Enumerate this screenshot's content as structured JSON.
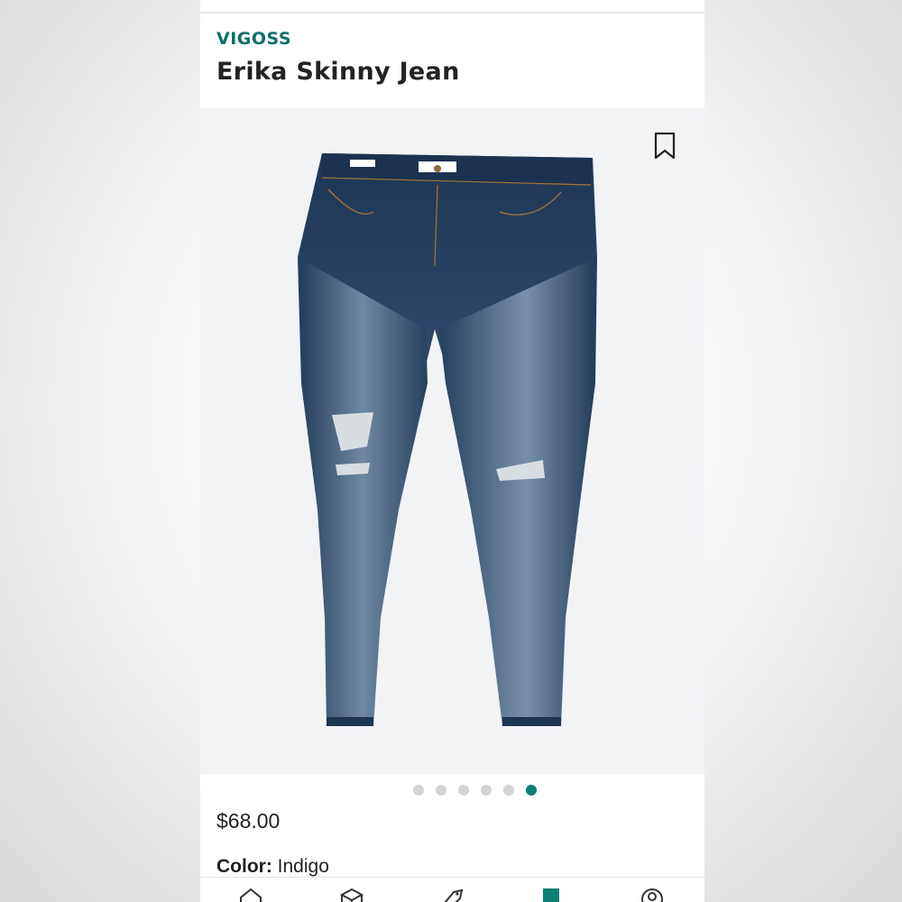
{
  "product": {
    "brand": "VIGOSS",
    "name": "Erika Skinny Jean",
    "price": "$68.00",
    "color_label": "Color:",
    "color_value": "Indigo"
  },
  "gallery": {
    "dot_count": 6,
    "active_index": 5
  },
  "tabs": [
    {
      "icon": "home-icon"
    },
    {
      "icon": "box-icon"
    },
    {
      "icon": "tag-icon"
    },
    {
      "icon": "bookmark-filled-icon"
    },
    {
      "icon": "profile-icon"
    }
  ],
  "colors": {
    "accent": "#0c7f76",
    "brand_text": "#0c6f69",
    "denim": "#2f4a6b"
  }
}
